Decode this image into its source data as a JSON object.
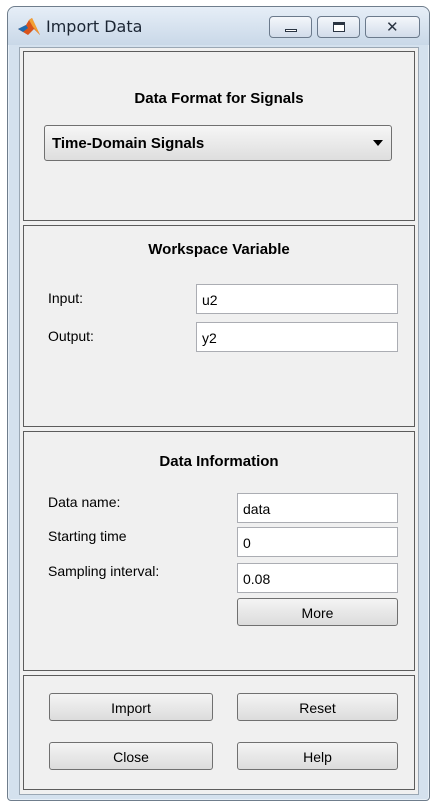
{
  "window": {
    "title": "Import Data",
    "controls": {
      "minimize": "minimize-icon",
      "maximize": "maximize-icon",
      "close": "close-icon"
    }
  },
  "data_format": {
    "heading": "Data Format for Signals",
    "selected": "Time-Domain Signals"
  },
  "workspace": {
    "heading": "Workspace Variable",
    "input_label": "Input:",
    "input_value": "u2",
    "output_label": "Output:",
    "output_value": "y2"
  },
  "info": {
    "heading": "Data Information",
    "name_label": "Data name:",
    "name_value": "data",
    "start_label": "Starting time",
    "start_value": "0",
    "interval_label": "Sampling interval:",
    "interval_value": "0.08",
    "more_label": "More"
  },
  "actions": {
    "import": "Import",
    "reset": "Reset",
    "close": "Close",
    "help": "Help"
  }
}
